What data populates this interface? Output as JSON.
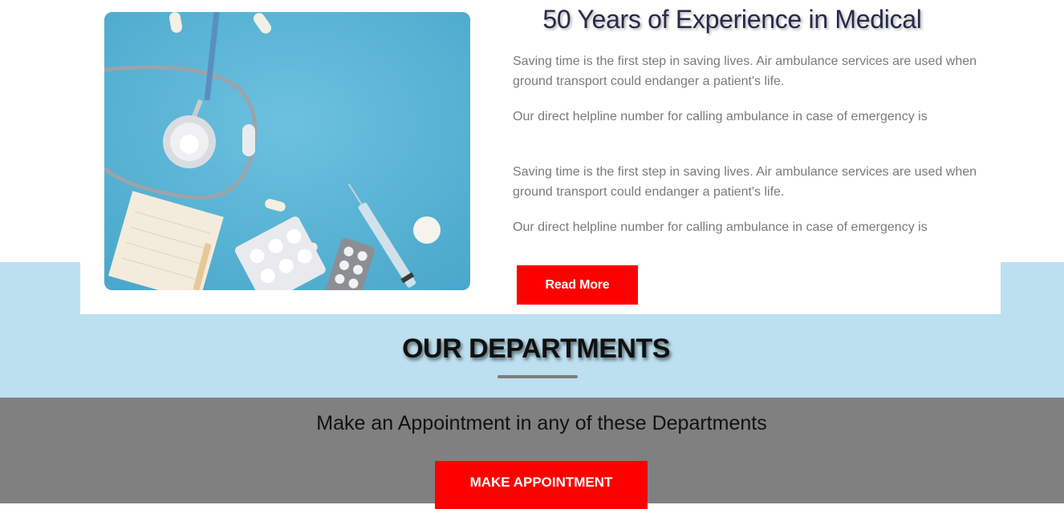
{
  "about": {
    "heading": "50 Years of Experience in Medical",
    "paragraphs": [
      "Saving time is the first step in saving lives. Air ambulance services are used when ground transport could endanger a patient's life.",
      "Our direct helpline number for calling ambulance in case of emergency is",
      "Saving time is the first step in saving lives. Air ambulance services are used when ground transport could endanger a patient's life.",
      "Our direct helpline number for calling ambulance in case of emergency is"
    ],
    "read_more_label": "Read More",
    "image_subject": "stethoscope-and-pills-photo"
  },
  "departments": {
    "title": "OUR DEPARTMENTS"
  },
  "appointment": {
    "text": "Make an Appointment in any of these Departments",
    "button_label": "MAKE APPOINTMENT"
  },
  "colors": {
    "accent_red": "#ff0000",
    "light_blue_band": "#bde0f0",
    "gray_band": "#808080",
    "heading_navy": "#262a4a",
    "body_text": "#7a7a7a",
    "photo_background": "#5fb6d6"
  }
}
